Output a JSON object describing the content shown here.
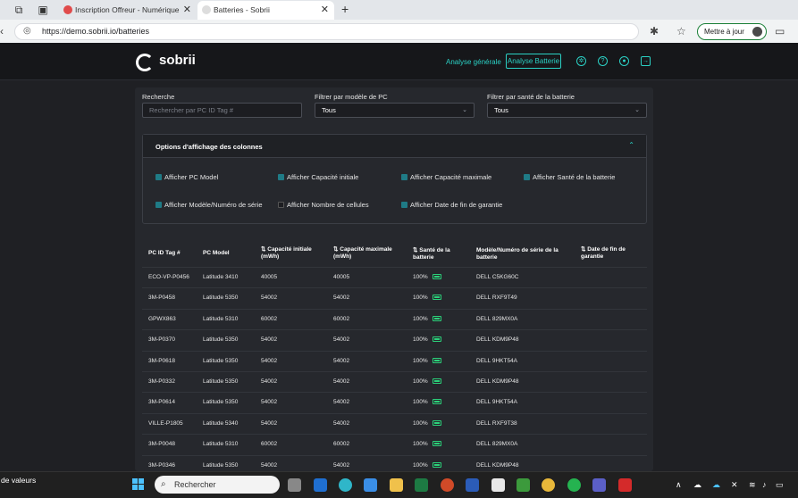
{
  "browser": {
    "tabs": [
      {
        "label": "Inscription Offreur - Numérique",
        "active": false
      },
      {
        "label": "Batteries - Sobrii",
        "active": true
      }
    ],
    "url": "https://demo.sobrii.io/batteries",
    "update_label": "Mettre à jour"
  },
  "header": {
    "logo": "sobrii",
    "nav_general": "Analyse générale",
    "nav_battery": "Analyse Batterie"
  },
  "filters": {
    "search_label": "Recherche",
    "search_placeholder": "Rechercher par PC ID Tag #",
    "model_label": "Filtrer par modèle de PC",
    "model_value": "Tous",
    "health_label": "Filtrer par santé de la batterie",
    "health_value": "Tous"
  },
  "options": {
    "title": "Options d'affichage des colonnes",
    "items": [
      {
        "label": "Afficher PC Model",
        "checked": true
      },
      {
        "label": "Afficher Capacité initiale",
        "checked": true
      },
      {
        "label": "Afficher Capacité maximale",
        "checked": true
      },
      {
        "label": "Afficher Santé de la batterie",
        "checked": true
      },
      {
        "label": "Afficher Modèle/Numéro de série",
        "checked": true
      },
      {
        "label": "Afficher Nombre de cellules",
        "checked": false
      },
      {
        "label": "Afficher Date de fin de garantie",
        "checked": true
      }
    ]
  },
  "table": {
    "headers": [
      "PC ID Tag #",
      "PC Model",
      "⇅ Capacité initiale (mWh)",
      "⇅ Capacité maximale (mWh)",
      "⇅ Santé de la batterie",
      "Modèle/Numéro de série de la batterie",
      "⇅ Date de fin de garantie"
    ],
    "rows": [
      [
        "ECO-VP-P0456",
        "Latitude 3410",
        "40005",
        "40005",
        "100%",
        "DELL C5KG60C",
        ""
      ],
      [
        "3M-P0458",
        "Latitude 5350",
        "54002",
        "54002",
        "100%",
        "DELL RXF9T49",
        ""
      ],
      [
        "GPWX863",
        "Latitude 5310",
        "60002",
        "60002",
        "100%",
        "DELL 829MX0A",
        ""
      ],
      [
        "3M-P0370",
        "Latitude 5350",
        "54002",
        "54002",
        "100%",
        "DELL KDM9P48",
        ""
      ],
      [
        "3M-P0618",
        "Latitude 5350",
        "54002",
        "54002",
        "100%",
        "DELL 9HKT54A",
        ""
      ],
      [
        "3M-P0332",
        "Latitude 5350",
        "54002",
        "54002",
        "100%",
        "DELL KDM9P48",
        ""
      ],
      [
        "3M-P0614",
        "Latitude 5350",
        "54002",
        "54002",
        "100%",
        "DELL 9HKT54A",
        ""
      ],
      [
        "VILLE-P1805",
        "Latitude 5340",
        "54002",
        "54002",
        "100%",
        "DELL RXF9T38",
        ""
      ],
      [
        "3M-P0048",
        "Latitude 5310",
        "60002",
        "60002",
        "100%",
        "DELL 829MX0A",
        ""
      ],
      [
        "3M-P0346",
        "Latitude 5350",
        "54002",
        "54002",
        "100%",
        "DELL KDM9P48",
        ""
      ]
    ]
  },
  "taskbar": {
    "left_text": "de valeurs",
    "search_label": "Rechercher"
  },
  "colors": {
    "accent": "#2bd1c5",
    "background": "#1f2024",
    "checkbox": "#1f7b86"
  }
}
